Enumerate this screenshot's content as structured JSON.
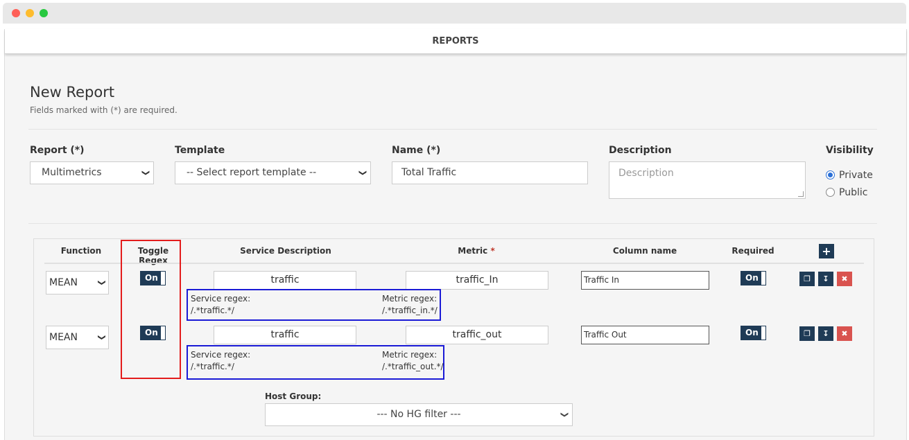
{
  "header": {
    "title": "REPORTS"
  },
  "form": {
    "heading": "New Report",
    "subtitle": "Fields marked with (*) are required.",
    "report": {
      "label": "Report (*)",
      "value": "Multimetrics"
    },
    "template": {
      "label": "Template",
      "value": "-- Select report template --"
    },
    "name": {
      "label": "Name (*)",
      "value": "Total Traffic"
    },
    "description": {
      "label": "Description",
      "placeholder": "Description"
    },
    "visibility": {
      "label": "Visibility",
      "options": [
        "Private",
        "Public"
      ],
      "selected": "Private"
    }
  },
  "table": {
    "headers": {
      "function": "Function",
      "toggle_regex": "Toggle Regex",
      "service": "Service Description",
      "metric": "Metric",
      "metric_required": "*",
      "column": "Column name",
      "required": "Required"
    },
    "add_icon": "plus-icon",
    "rows": [
      {
        "function": "MEAN",
        "toggle": "On",
        "service": "traffic",
        "metric": "traffic_In",
        "column": "Traffic In",
        "required": "On",
        "service_regex_label": "Service regex:",
        "service_regex": "/.*traffic.*/",
        "metric_regex_label": "Metric regex:",
        "metric_regex": "/.*traffic_in.*/"
      },
      {
        "function": "MEAN",
        "toggle": "On",
        "service": "traffic",
        "metric": "traffic_out",
        "column": "Traffic Out",
        "required": "On",
        "service_regex_label": "Service regex:",
        "service_regex": "/.*traffic.*/",
        "metric_regex_label": "Metric regex:",
        "metric_regex": "/.*traffic_out.*/"
      }
    ],
    "row_actions": [
      "copy-icon",
      "move-down-icon",
      "close-icon"
    ]
  },
  "host_group": {
    "label": "Host Group:",
    "value": "--- No HG filter ---"
  },
  "colors": {
    "accent": "#1f3b56",
    "danger": "#d9534f",
    "highlight_red": "#e31b1b",
    "highlight_blue": "#1a1ad6",
    "radio": "#2a6fd6"
  }
}
